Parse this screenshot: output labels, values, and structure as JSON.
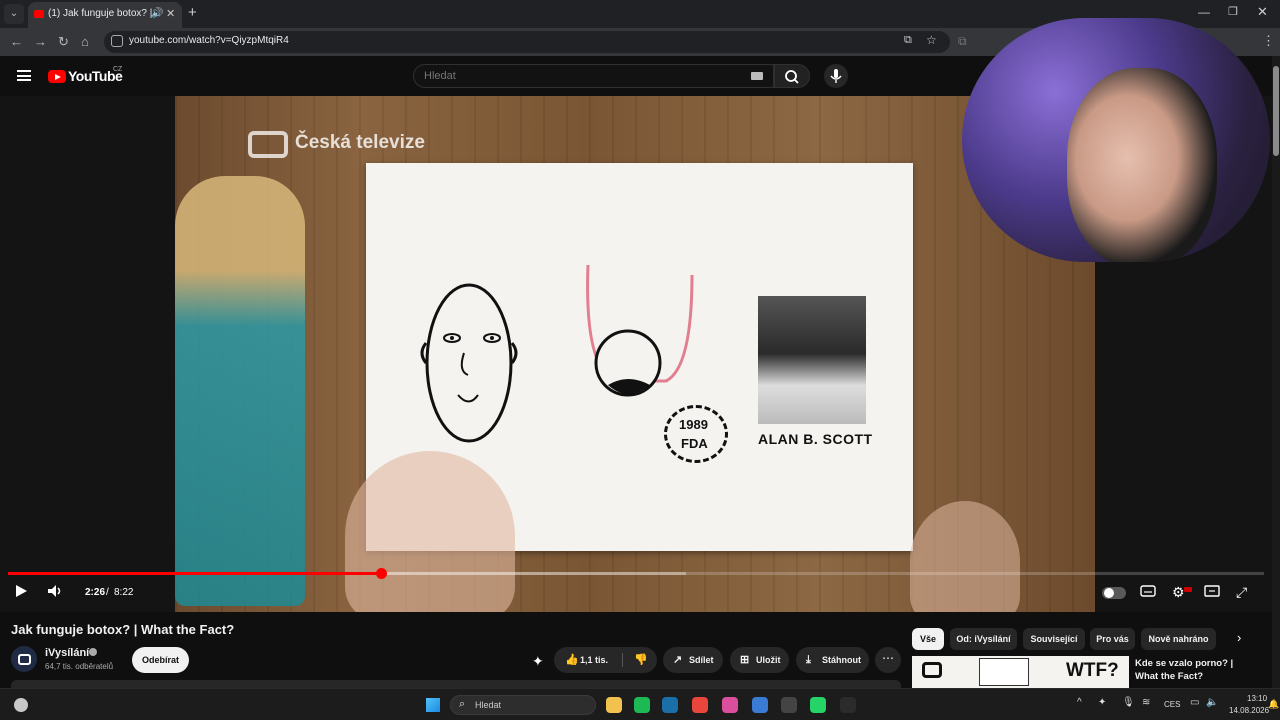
{
  "browser": {
    "tab_title": "(1) Jak funguje botox? | What the Fact?",
    "tab_audio_icon": "speaker-icon",
    "url": "youtube.com/watch?v=QiyzpMtqiR4"
  },
  "youtube": {
    "logo_text": "YouTube",
    "country": "CZ",
    "search_placeholder": "Hledat"
  },
  "video": {
    "overlay_brand": "Česká televize",
    "stamp_year": "1989",
    "stamp_text": "FDA",
    "photo_caption": "ALAN B. SCOTT",
    "progress_fraction": 0.2966,
    "buffer_fraction": 0.54,
    "time_current": "2:26",
    "time_separator": "/",
    "time_total": "8:22"
  },
  "meta": {
    "title": "Jak funguje botox? | What the Fact?",
    "channel": "iVysílání",
    "subscribers": "64,7 tis. odběratelů",
    "subscribe_label": "Odebírat",
    "likes": "1,1 tis.",
    "share_label": "Sdílet",
    "save_label": "Uložit",
    "download_label": "Stáhnout"
  },
  "chips": [
    "Vše",
    "Od: iVysílání",
    "Související",
    "Pro vás",
    "Nově nahráno"
  ],
  "recommendation": {
    "title": "Kde se vzalo porno? | What the Fact?",
    "thumb_text": "WTF?"
  },
  "taskbar": {
    "search_placeholder": "Hledat",
    "language": "CES",
    "time": "13:10",
    "date": "14.08.2026",
    "apps": [
      {
        "name": "file-explorer-icon",
        "color": "#f2c14e"
      },
      {
        "name": "spotify-icon",
        "color": "#1db954"
      },
      {
        "name": "steam-icon",
        "color": "#1b6fa8"
      },
      {
        "name": "chrome-icon",
        "color": "#e8453c"
      },
      {
        "name": "photos-icon",
        "color": "#d94f9b"
      },
      {
        "name": "save-disk-icon",
        "color": "#3a7bd5"
      },
      {
        "name": "obs-icon",
        "color": "#444444"
      },
      {
        "name": "whatsapp-icon",
        "color": "#25d366"
      },
      {
        "name": "epic-games-icon",
        "color": "#2b2b2b"
      }
    ]
  }
}
